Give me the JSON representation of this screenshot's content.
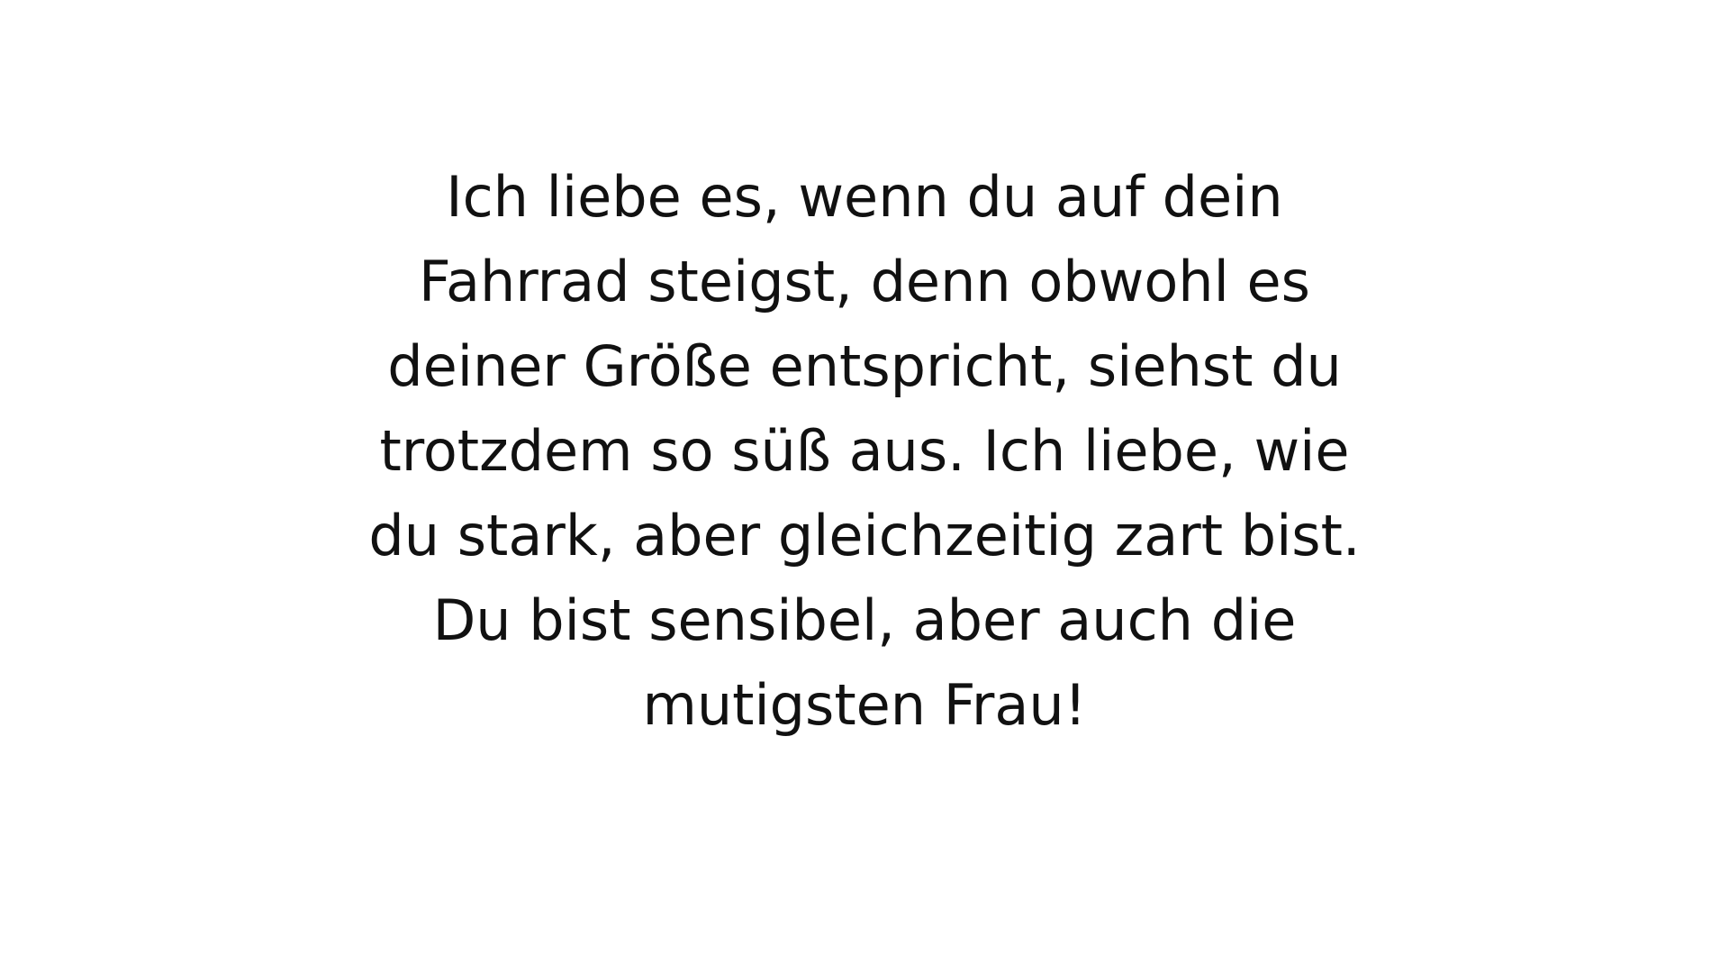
{
  "colors": {
    "background": "#ffffff",
    "text": "#111111"
  },
  "quote": {
    "lines": [
      "Ich liebe es, wenn du auf dein",
      "Fahrrad steigst, denn obwohl es",
      "deiner Größe entspricht, siehst du",
      "trotzdem so süß aus. Ich liebe, wie",
      "du stark, aber gleichzeitig zart bist.",
      "Du bist sensibel, aber auch die",
      "mutigsten Frau!"
    ]
  }
}
